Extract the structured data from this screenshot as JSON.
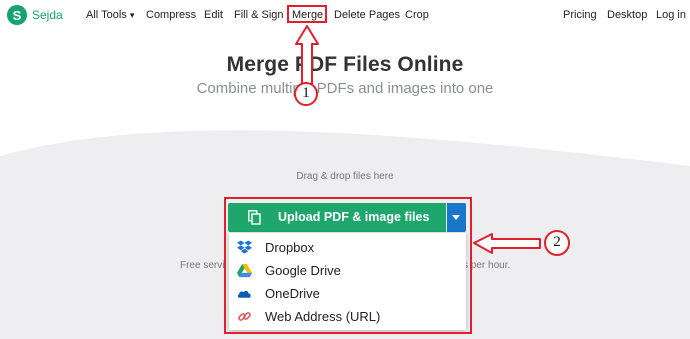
{
  "brand": {
    "name": "Sejda",
    "logo_letter": "S",
    "color": "#17a36f"
  },
  "nav": {
    "items": [
      "All Tools",
      "Compress",
      "Edit",
      "Fill & Sign",
      "Merge",
      "Delete Pages",
      "Crop"
    ],
    "all_tools_caret": "▾",
    "right": [
      "Pricing",
      "Desktop",
      "Log in"
    ]
  },
  "hero": {
    "title": "Merge PDF Files Online",
    "subtitle": "Combine multiple PDFs and images into one"
  },
  "upload": {
    "drag_text": "Drag & drop files here",
    "button_label": "Upload PDF & image files",
    "button_color": "#1ea66d",
    "toggle_color": "#1a76c8"
  },
  "menu": {
    "items": [
      {
        "label": "Dropbox",
        "icon": "dropbox-icon"
      },
      {
        "label": "Google Drive",
        "icon": "google-drive-icon"
      },
      {
        "label": "OneDrive",
        "icon": "onedrive-icon"
      },
      {
        "label": "Web Address (URL)",
        "icon": "link-icon"
      }
    ]
  },
  "background_text": {
    "left": "Free servi",
    "right": "s per hour."
  },
  "annotations": {
    "step1": "1",
    "step2": "2",
    "color": "#e0202a"
  }
}
